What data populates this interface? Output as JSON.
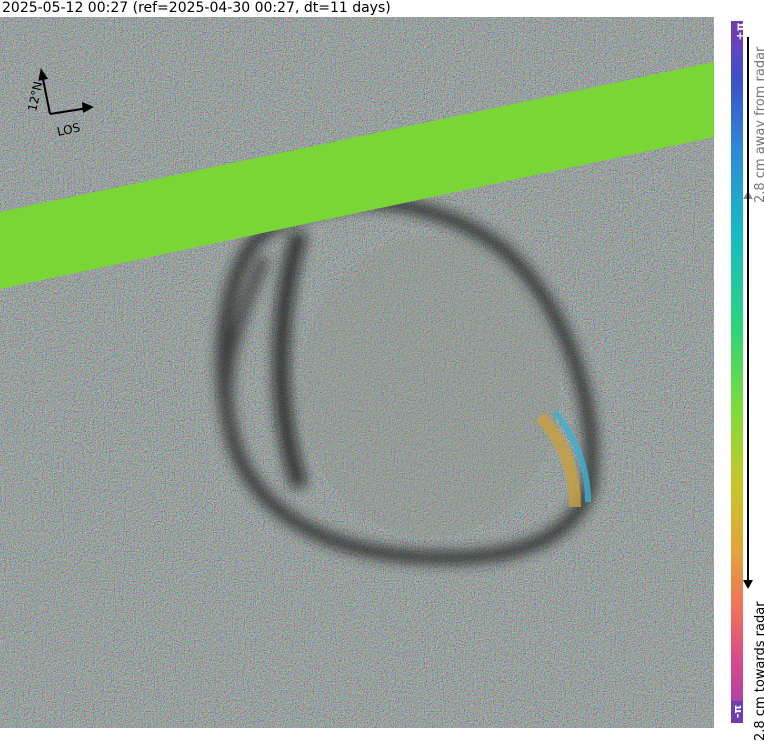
{
  "header": {
    "title": "2025-05-12 00:27 (ref=2025-04-30 00:27, dt=11 days)"
  },
  "compass": {
    "north_label": "12°N",
    "los_label": "LOS"
  },
  "colorbar": {
    "top_symbol": "+π",
    "bottom_symbol": "-π",
    "top_label": "2.8 cm away from radar",
    "bottom_label": "2.8 cm towards radar",
    "colors": [
      "#7f3fbd",
      "#2f88d6",
      "#19b9c6",
      "#2fd47a",
      "#7ddc3b",
      "#c7c72b",
      "#f06f5a",
      "#9a3fb4"
    ]
  },
  "overlay": {
    "band_color": "#7fdc3a"
  }
}
